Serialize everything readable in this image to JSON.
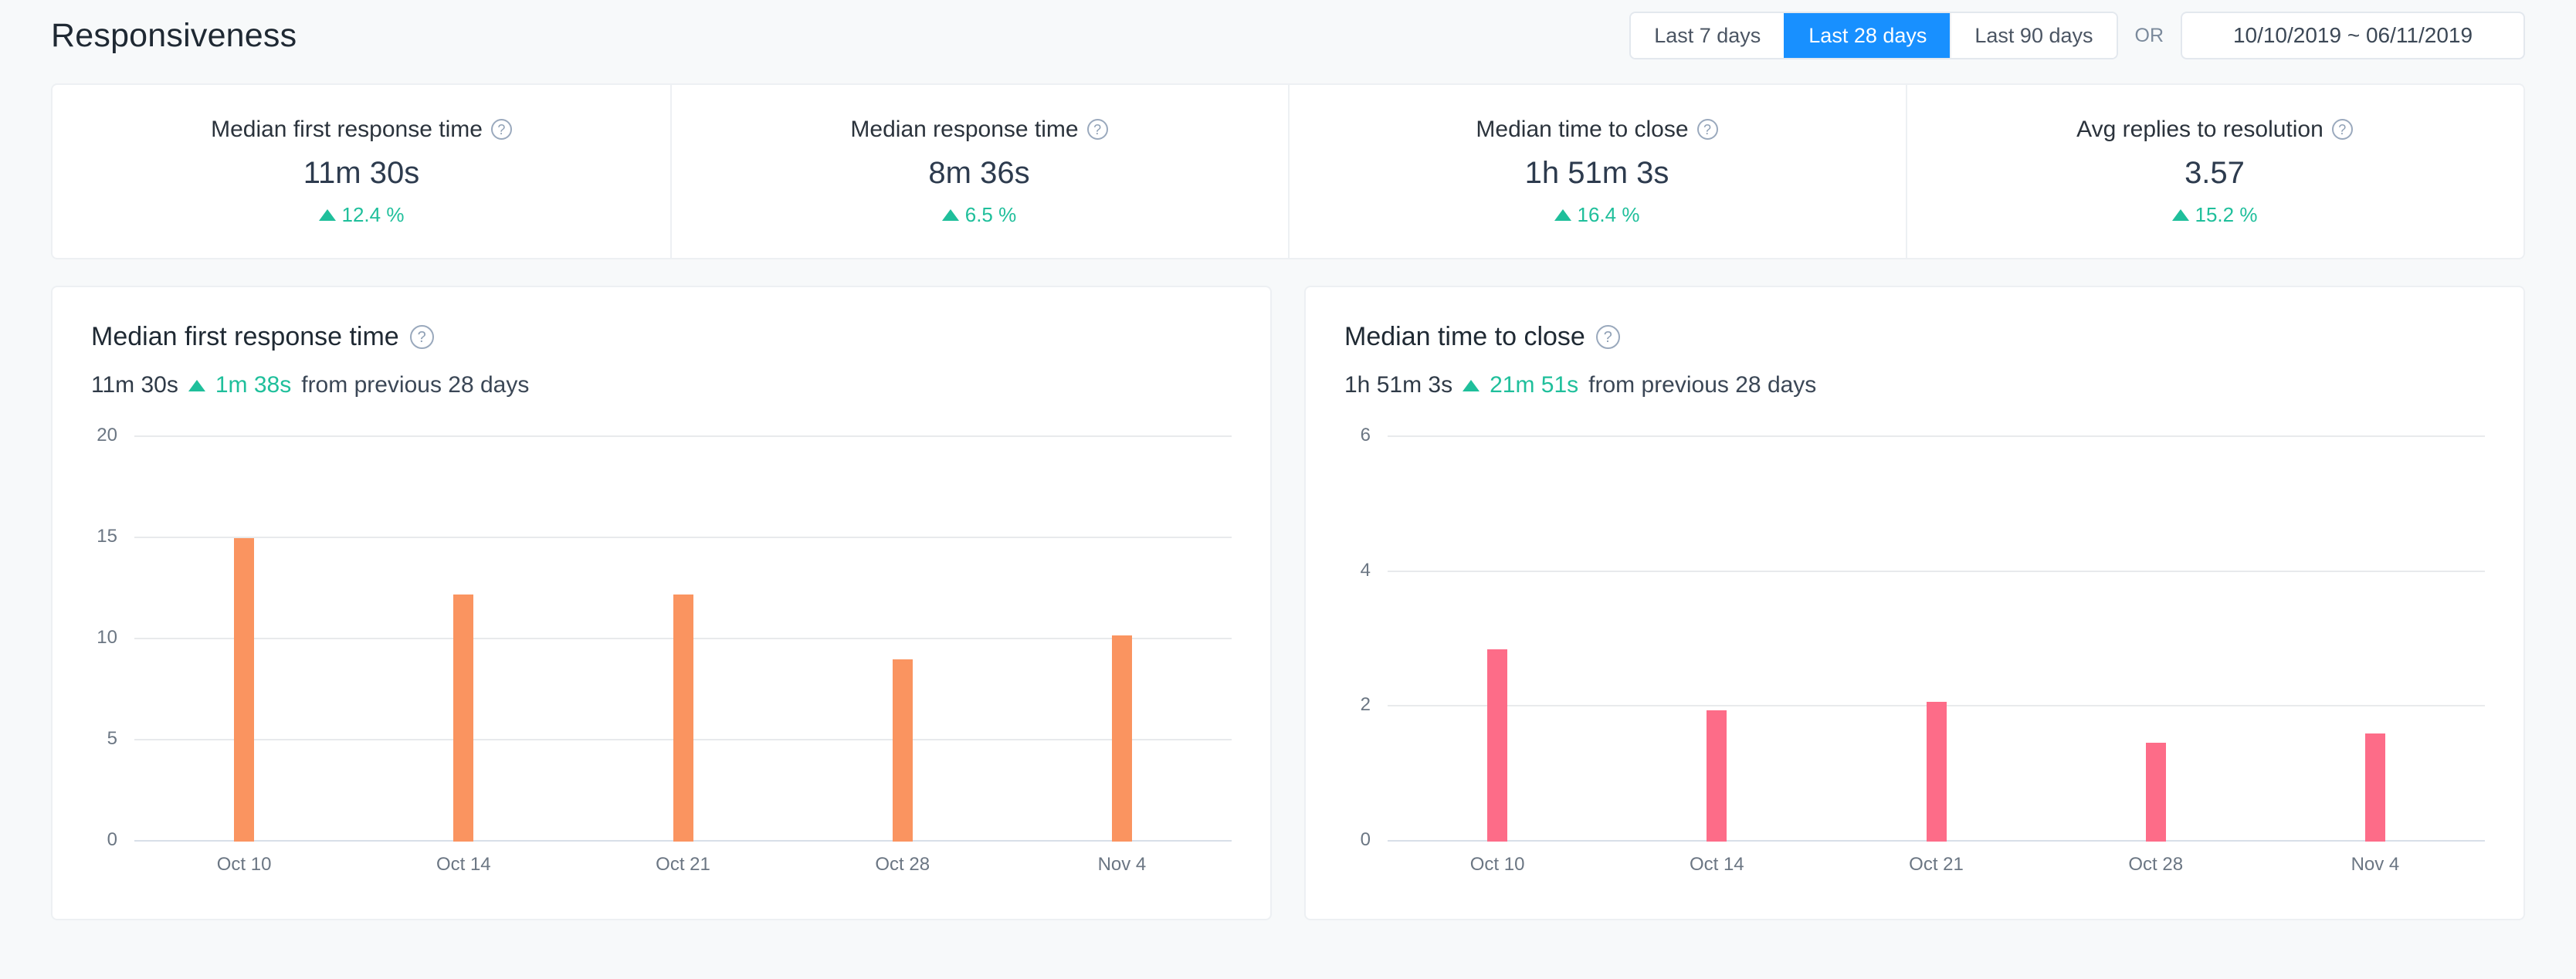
{
  "header": {
    "title": "Responsiveness",
    "or_label": "OR",
    "ranges": [
      {
        "label": "Last 7 days",
        "active": false
      },
      {
        "label": "Last 28 days",
        "active": true
      },
      {
        "label": "Last 90 days",
        "active": false
      }
    ],
    "date_range": "10/10/2019  ~  06/11/2019"
  },
  "colors": {
    "accent_blue": "#1890ff",
    "positive_green": "#1fbf9b",
    "bar_orange": "#fa9460",
    "bar_pink": "#fd6c88",
    "page_bg": "#f7f9fa",
    "card_border": "#edf0f3",
    "gridline": "#e8eaec"
  },
  "kpis": [
    {
      "label": "Median first response time",
      "help_icon": "question-circle-icon",
      "value": "11m 30s",
      "delta_icon": "triangle-up-icon",
      "delta": "12.4 %"
    },
    {
      "label": "Median response time",
      "help_icon": "question-circle-icon",
      "value": "8m 36s",
      "delta_icon": "triangle-up-icon",
      "delta": "6.5 %"
    },
    {
      "label": "Median time to close",
      "help_icon": "question-circle-icon",
      "value": "1h 51m 3s",
      "delta_icon": "triangle-up-icon",
      "delta": "16.4 %"
    },
    {
      "label": "Avg replies to resolution",
      "help_icon": "question-circle-icon",
      "value": "3.57",
      "delta_icon": "triangle-up-icon",
      "delta": "15.2 %"
    }
  ],
  "charts": [
    {
      "title": "Median first response time",
      "help_icon": "question-circle-icon",
      "summary_value": "11m 30s",
      "delta_icon": "triangle-up-icon",
      "delta_value": "1m 38s",
      "delta_suffix": "from previous 28 days"
    },
    {
      "title": "Median time to close",
      "help_icon": "question-circle-icon",
      "summary_value": "1h 51m 3s",
      "delta_icon": "triangle-up-icon",
      "delta_value": "21m 51s",
      "delta_suffix": "from previous 28 days"
    }
  ],
  "chart_data": [
    {
      "type": "bar",
      "title": "Median first response time",
      "xlabel": "",
      "ylabel": "",
      "categories": [
        "Oct 10",
        "Oct 14",
        "Oct 21",
        "Oct 28",
        "Nov 4"
      ],
      "values": [
        15.0,
        12.2,
        12.2,
        9.0,
        10.2
      ],
      "yticks": [
        0,
        5,
        10,
        15,
        20
      ],
      "ylim": [
        0,
        20
      ],
      "grid": true,
      "legend": "none",
      "bar_color": "#fa9460"
    },
    {
      "type": "bar",
      "title": "Median time to close",
      "xlabel": "",
      "ylabel": "",
      "categories": [
        "Oct 10",
        "Oct 14",
        "Oct 21",
        "Oct 28",
        "Nov 4"
      ],
      "values": [
        2.85,
        1.95,
        2.07,
        1.47,
        1.6
      ],
      "yticks": [
        0,
        2,
        4,
        6
      ],
      "ylim": [
        0,
        6
      ],
      "grid": true,
      "legend": "none",
      "bar_color": "#fd6c88"
    }
  ]
}
